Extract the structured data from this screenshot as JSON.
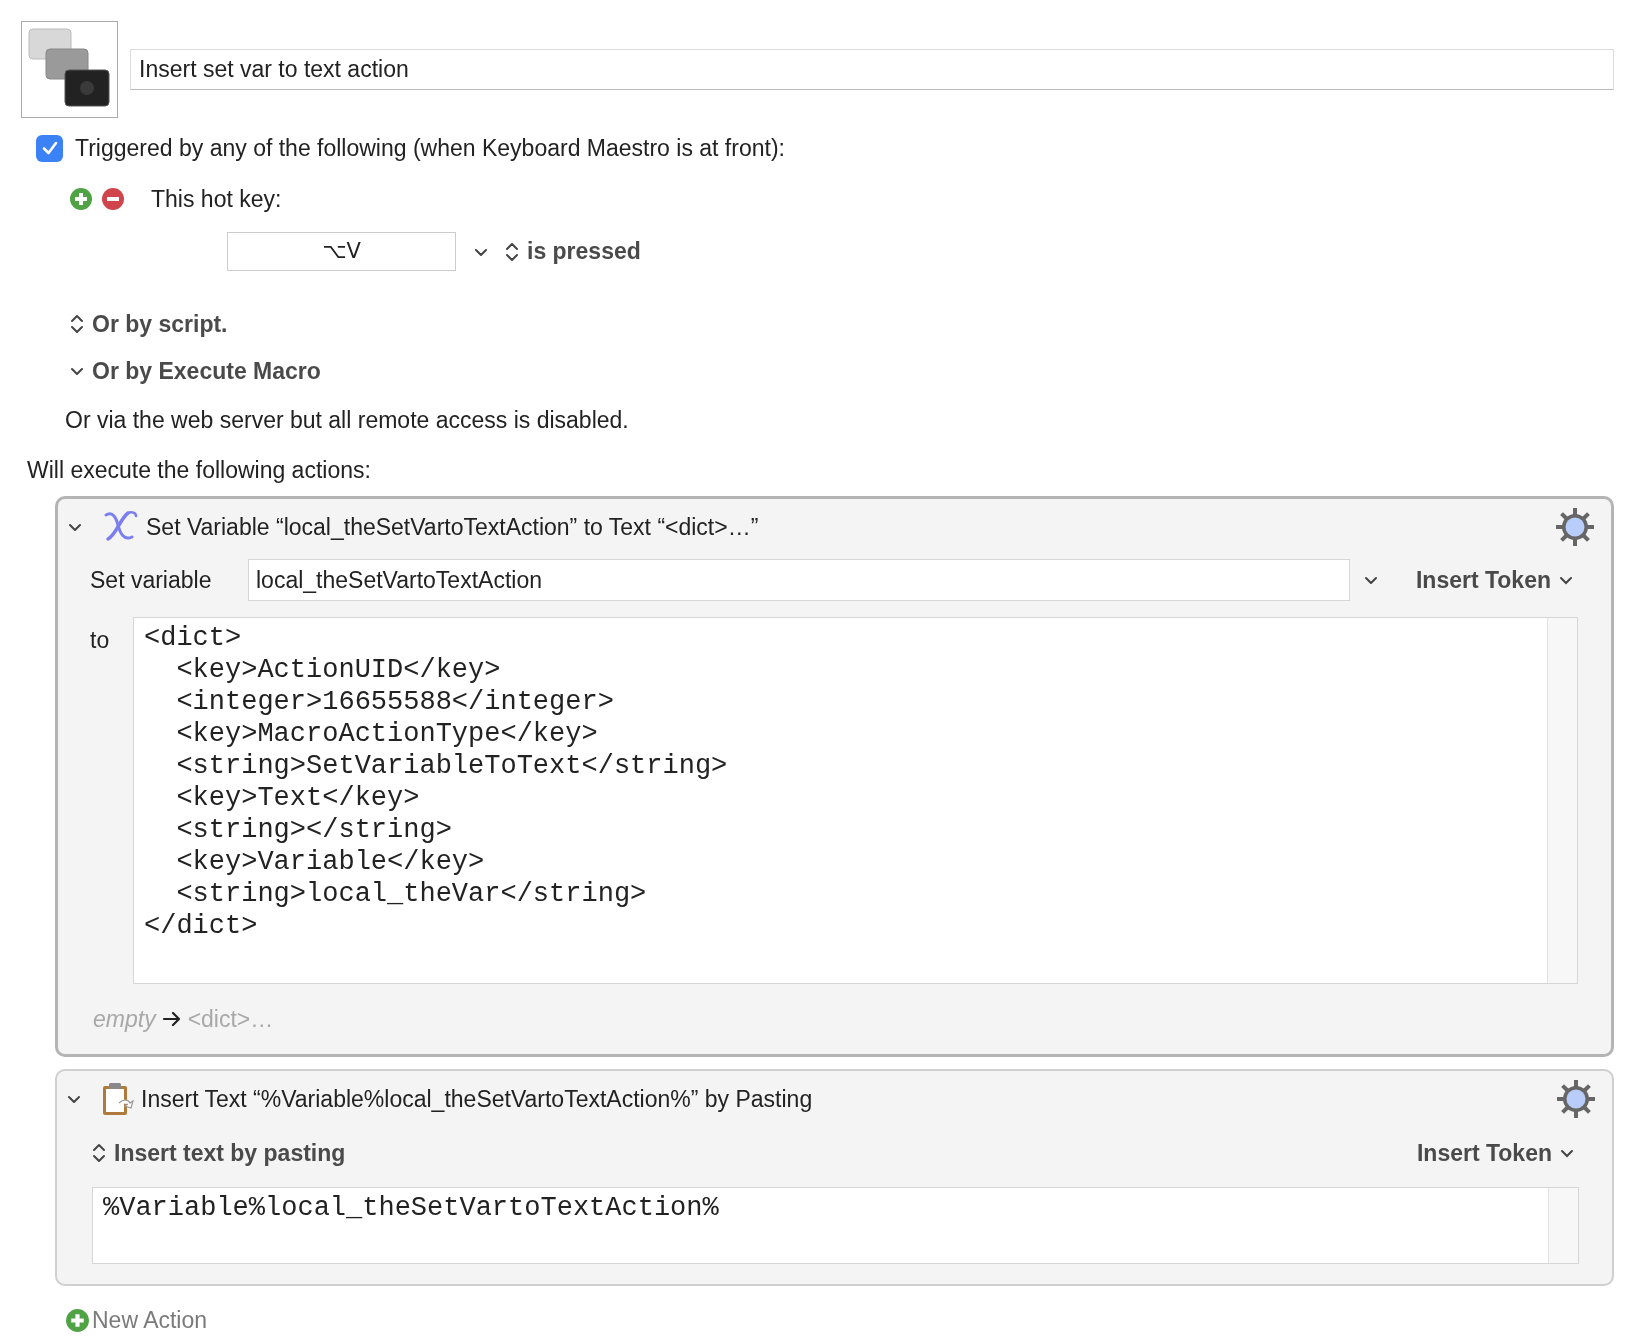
{
  "macro": {
    "name": "Insert set var to text action"
  },
  "trigger": {
    "checked": true,
    "label": "Triggered by any of the following (when Keyboard Maestro is at front):",
    "hotkey": {
      "label": "This hot key:",
      "value": "⌥V",
      "condition": "is pressed"
    },
    "script": "Or by script.",
    "execute_macro": {
      "label": "Or by Execute Macro",
      "expanded": true
    },
    "web_server": "Or via the web server but all remote access is disabled."
  },
  "actions_heading": "Will execute the following actions:",
  "actions": [
    {
      "kind": "set_variable",
      "selected": true,
      "expanded": true,
      "title": "Set Variable “local_theSetVartoTextAction” to Text “<dict>…”",
      "field_label": "Set variable",
      "variable": "local_theSetVartoTextAction",
      "insert_token": "Insert Token",
      "to_label": "to",
      "text": "<dict>\n  <key>ActionUID</key>\n  <integer>16655588</integer>\n  <key>MacroActionType</key>\n  <string>SetVariableToText</string>\n  <key>Text</key>\n  <string></string>\n  <key>Variable</key>\n  <string>local_theVar</string>\n</dict>",
      "summary_from": "empty",
      "summary_to": "<dict>…"
    },
    {
      "kind": "insert_text",
      "selected": false,
      "expanded": true,
      "title": "Insert Text “%Variable%local_theSetVartoTextAction%” by Pasting",
      "mode": "Insert text by pasting",
      "insert_token": "Insert Token",
      "text": "%Variable%local_theSetVartoTextAction%"
    }
  ],
  "new_action": "New Action"
}
